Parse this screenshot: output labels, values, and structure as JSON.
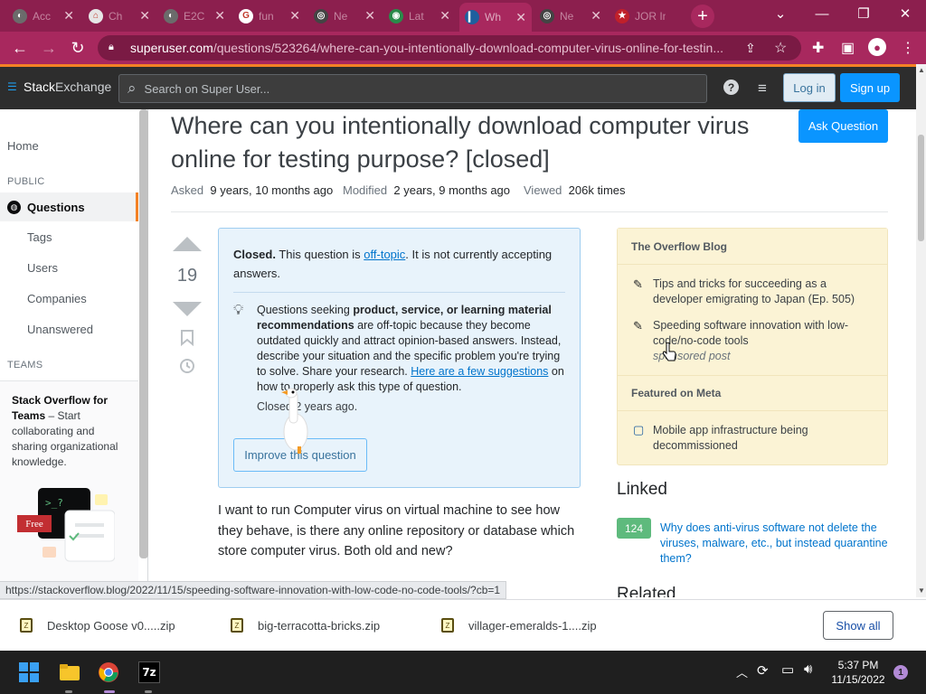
{
  "browser": {
    "tabs": [
      {
        "title": "Acc",
        "fav_color": "#6b6b6b",
        "fav_glyph": "◐"
      },
      {
        "title": "Ch",
        "fav_color": "#e6e6e6",
        "fav_glyph": "⌂"
      },
      {
        "title": "E2C",
        "fav_color": "#6b6b6b",
        "fav_glyph": "◐"
      },
      {
        "title": "fun",
        "fav_color": "#ffffff",
        "fav_glyph": "G"
      },
      {
        "title": "Ne",
        "fav_color": "#444",
        "fav_glyph": "◎"
      },
      {
        "title": "Lat",
        "fav_color": "#2a8a4a",
        "fav_glyph": "◉"
      },
      {
        "title": "Wh",
        "fav_color": "#1e5f9e",
        "fav_glyph": "▎"
      },
      {
        "title": "Ne",
        "fav_color": "#444",
        "fav_glyph": "◎"
      },
      {
        "title": "JOR Int",
        "fav_color": "#c0202a",
        "fav_glyph": "★"
      }
    ],
    "new_tab_glyph": "+",
    "url_domain": "superuser.com",
    "url_path": "/questions/523264/where-can-you-intentionally-download-computer-virus-online-for-testin..."
  },
  "header": {
    "logo_stack": "Stack",
    "logo_exchange": "Exchange",
    "search_placeholder": "Search on Super User...",
    "login_label": "Log in",
    "signup_label": "Sign up"
  },
  "nav": {
    "home": "Home",
    "public_section": "PUBLIC",
    "questions": "Questions",
    "tags": "Tags",
    "users": "Users",
    "companies": "Companies",
    "unanswered": "Unanswered",
    "teams_section": "TEAMS",
    "teams_title": "Stack Overflow for Teams",
    "teams_desc": " – Start collaborating and sharing organizational knowledge.",
    "free_badge": "Free"
  },
  "question": {
    "title": "Where can you intentionally download computer virus online for testing purpose? [closed]",
    "ask_label": "Ask Question",
    "asked_label": "Asked",
    "asked_value": "9 years, 10 months ago",
    "modified_label": "Modified",
    "modified_value": "2 years, 9 months ago",
    "viewed_label": "Viewed",
    "viewed_value": "206k times",
    "votes": "19",
    "body": "I want to run Computer virus on virtual machine to see how they behave, is there any online repository or database which store computer virus. Both old and new?"
  },
  "closed_notice": {
    "closed_word": "Closed.",
    "pre_link": " This question is ",
    "link": "off-topic",
    "post_link": ". It is not currently accepting answers.",
    "reason_1": "Questions seeking ",
    "reason_bold": "product, service, or learning material recommendations",
    "reason_2": " are off-topic because they become outdated quickly and attract opinion-based answers. Instead, describe your situation and the specific problem you're trying to solve. Share your research. ",
    "reason_link": "Here are a few suggestions",
    "reason_3": " on how to properly ask this type of question.",
    "closed_ago": "Closed 2 years ago.",
    "improve_label": "Improve this question"
  },
  "sidebar": {
    "blog_heading": "The Overflow Blog",
    "blog_items": [
      "Tips and tricks for succeeding as a developer emigrating to Japan (Ep. 505)",
      "Speeding software innovation with low-code/no-code tools"
    ],
    "sponsored": "sponsored post",
    "meta_heading": "Featured on Meta",
    "meta_items": [
      "Mobile app infrastructure being decommissioned"
    ],
    "linked_heading": "Linked",
    "linked_count": "124",
    "linked_text": "Why does anti-virus software not delete the viruses, malware, etc., but instead quarantine them?",
    "related_heading": "Related"
  },
  "status_url": "https://stackoverflow.blog/2022/11/15/speeding-software-innovation-with-low-code-no-code-tools/?cb=1",
  "downloads": {
    "files": [
      "Desktop Goose v0.....zip",
      "big-terracotta-bricks.zip",
      "villager-emeralds-1....zip"
    ],
    "show_all": "Show all"
  },
  "taskbar": {
    "time": "5:37 PM",
    "date": "11/15/2022",
    "notif_count": "1"
  },
  "colors": {
    "accent": "#0a95ff",
    "brand_orange": "#f48225",
    "browser_theme": "#a8285e"
  }
}
